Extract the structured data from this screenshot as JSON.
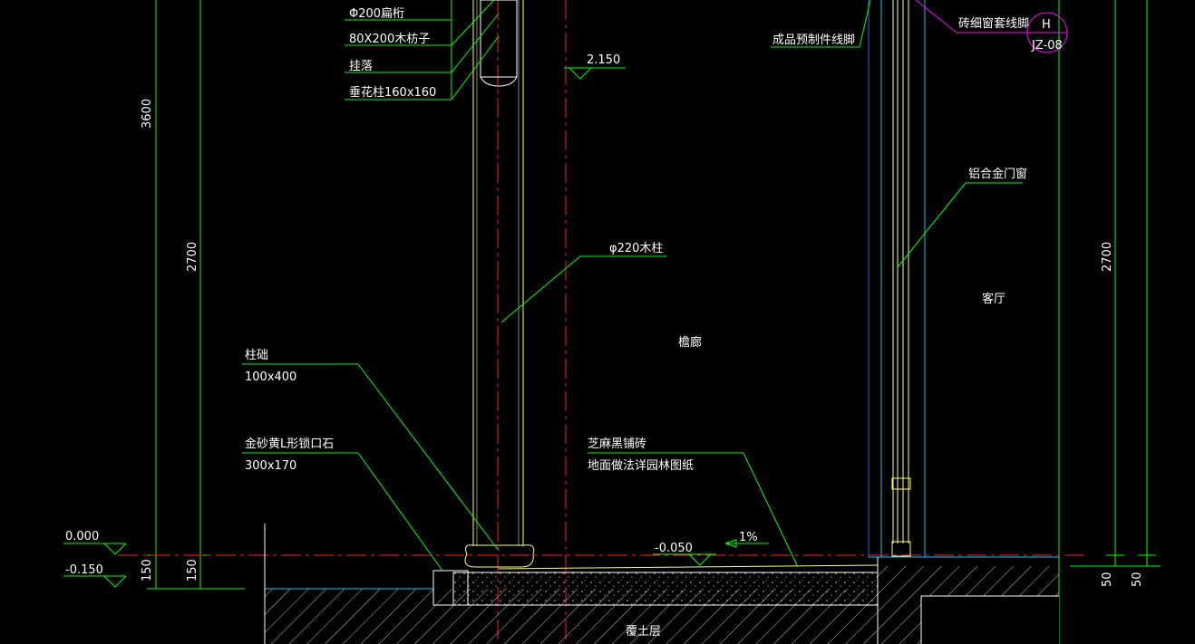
{
  "colors": {
    "background": "#000000",
    "green": "#00ff00",
    "yellow": "#ffff66",
    "red": "#ff2020",
    "cyan": "#00c8ff",
    "blue": "#3a5cff",
    "magenta": "#ff00ff",
    "white": "#ffffff"
  },
  "rooms": {
    "corridor": "檐廊",
    "living_room": "客厅",
    "fill_layer": "覆土层"
  },
  "callouts": {
    "top_1": "Φ200扁桁",
    "top_2": "80X200木枋子",
    "top_3": "挂落",
    "top_4": "垂花柱160x160",
    "column": "φ220木柱",
    "base_title": "柱础",
    "base_size": "100x400",
    "curb_title": "金砂黄L形锁口石",
    "curb_size": "300x170",
    "paving_1": "芝麻黑铺砖",
    "paving_2": "地面做法详园林图纸",
    "precast_line": "成品预制件线脚",
    "aluminum": "铝合金门窗",
    "sill": "砖细窗套线脚"
  },
  "detail_ref": {
    "letter": "H",
    "sheet": "JZ-08"
  },
  "elevations": {
    "el_2150": "2.150",
    "el_0000": "0.000",
    "el_m0150": "-0.150",
    "el_m0050": "-0.050",
    "slope": "1%"
  },
  "dimensions": {
    "left_3600": "3600",
    "left_2700": "2700",
    "left_150a": "150",
    "left_150b": "150",
    "right_2700": "2700",
    "right_50a": "50",
    "right_50b": "50"
  }
}
